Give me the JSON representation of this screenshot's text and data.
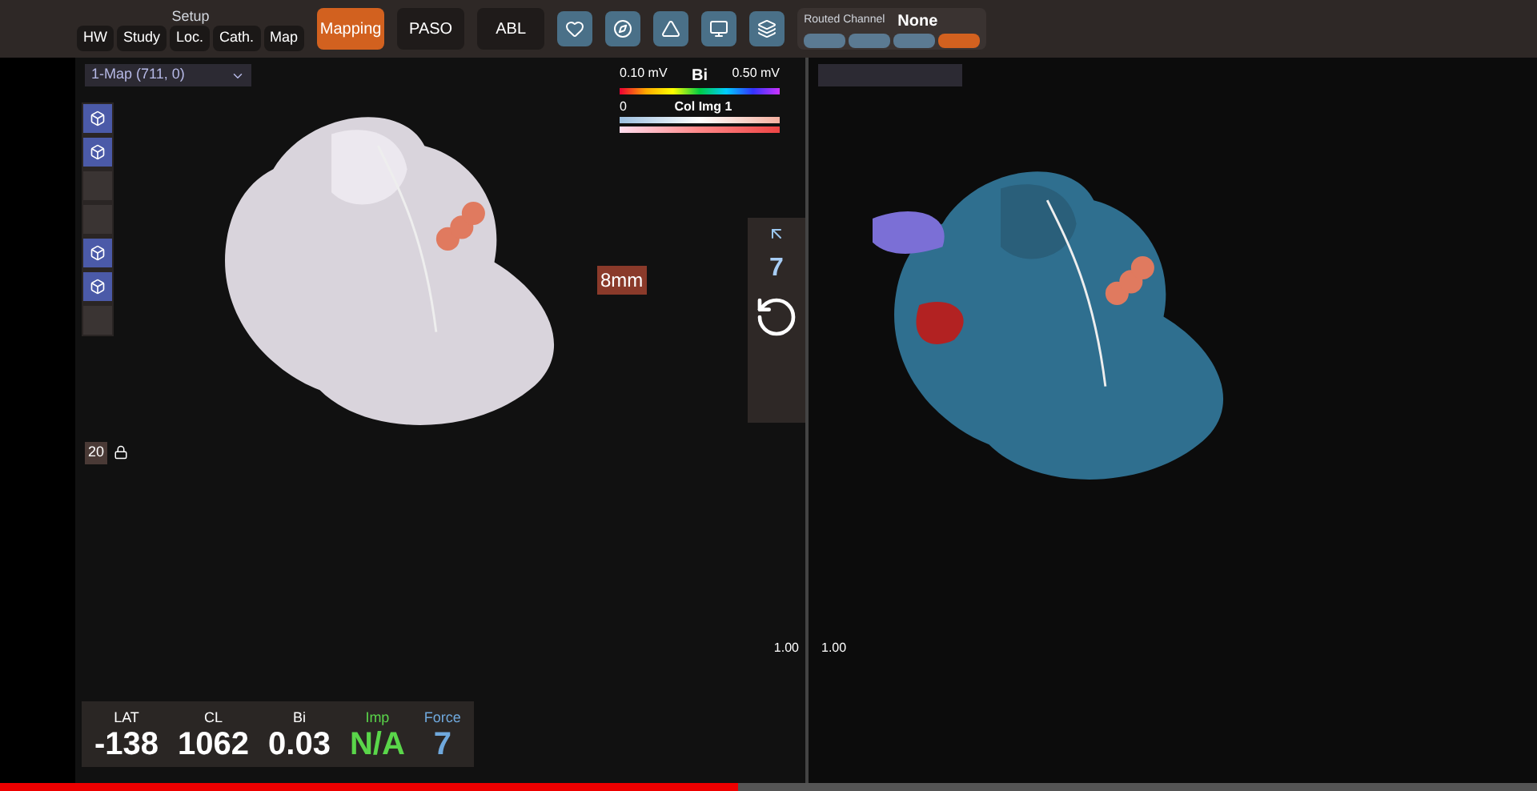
{
  "toolbar": {
    "setup_label": "Setup",
    "setup_tabs": [
      {
        "label": "HW",
        "selected": false
      },
      {
        "label": "Study",
        "selected": false
      },
      {
        "label": "Loc.",
        "selected": false
      },
      {
        "label": "Cath.",
        "selected": false
      },
      {
        "label": "Map",
        "selected": false
      }
    ],
    "modes": [
      {
        "label": "Mapping",
        "selected": true
      },
      {
        "label": "PASO",
        "selected": false
      },
      {
        "label": "ABL",
        "selected": false
      }
    ],
    "routed_channel": {
      "label": "Routed Channel",
      "value": "None",
      "channels": [
        {
          "selected": false
        },
        {
          "selected": false
        },
        {
          "selected": false
        },
        {
          "selected": true
        }
      ]
    }
  },
  "left_view": {
    "map_select": "1-Map (711, 0)",
    "tools": [
      {
        "enabled": true
      },
      {
        "enabled": true
      },
      {
        "enabled": false
      },
      {
        "enabled": false
      },
      {
        "enabled": true
      },
      {
        "enabled": true
      },
      {
        "enabled": false
      }
    ],
    "legend": {
      "min": "0.10 mV",
      "name": "Bi",
      "max": "0.50 mV",
      "zero": "0",
      "image": "Col Img 1"
    },
    "distance_label": "8mm",
    "force_value": "7",
    "zoom_value": "20",
    "readouts": [
      {
        "label": "LAT",
        "value": "-138",
        "kind": "plain"
      },
      {
        "label": "CL",
        "value": "1062",
        "kind": "plain"
      },
      {
        "label": "Bi",
        "value": "0.03",
        "kind": "plain"
      },
      {
        "label": "Imp",
        "value": "N/A",
        "kind": "impedance"
      },
      {
        "label": "Force",
        "value": "7",
        "kind": "force"
      }
    ],
    "scale_label": "1.00"
  },
  "right_view": {
    "scale_label": "1.00"
  },
  "video_progress": {
    "level": 0.48
  }
}
